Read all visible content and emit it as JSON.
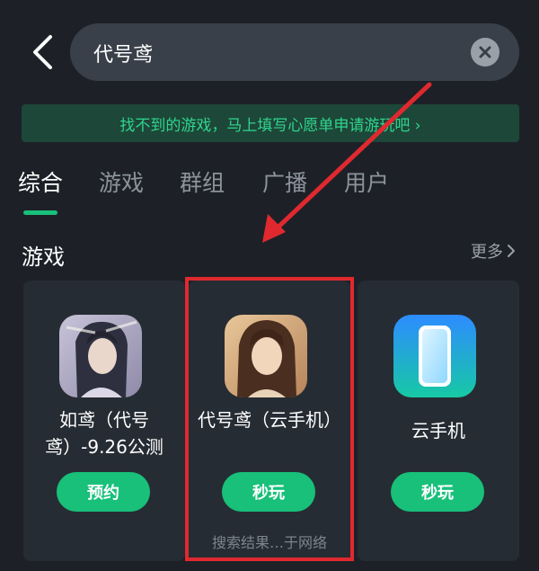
{
  "search": {
    "value": "代号鸢"
  },
  "banner": {
    "text": "找不到的游戏，马上填写心愿单申请游玩吧 ›"
  },
  "tabs": [
    {
      "label": "综合",
      "active": true
    },
    {
      "label": "游戏"
    },
    {
      "label": "群组"
    },
    {
      "label": "广播"
    },
    {
      "label": "用户"
    }
  ],
  "section": {
    "title": "游戏",
    "more": "更多"
  },
  "games": [
    {
      "name": "如鸢（代号鸢）-9.26公测",
      "button": "预约",
      "icon": "game-portrait-icon"
    },
    {
      "name": "代号鸢（云手机）",
      "button": "秒玩",
      "note": "搜索结果…于网络",
      "icon": "game-portrait-icon"
    },
    {
      "name": "云手机",
      "button": "秒玩",
      "icon": "cloud-phone-icon"
    }
  ],
  "colors": {
    "accent": "#18c07a",
    "highlight": "#e0292f",
    "background": "#1d2127"
  }
}
